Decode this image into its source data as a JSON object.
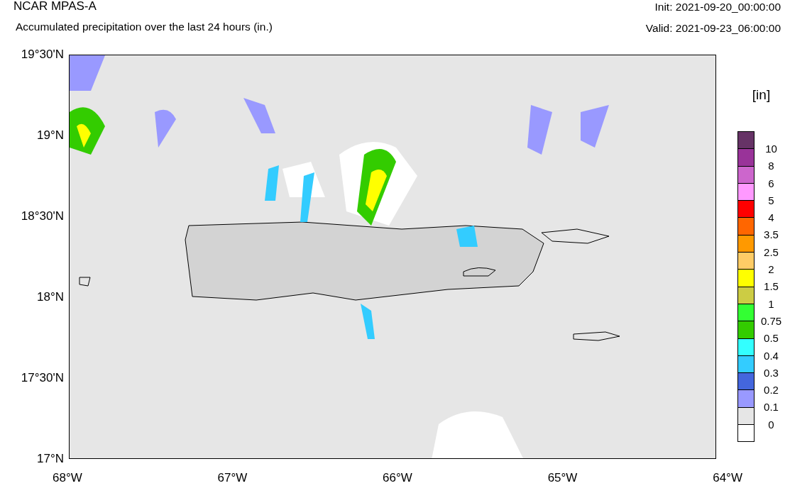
{
  "header": {
    "model": "NCAR MPAS-A",
    "subtitle": "Accumulated precipitation over the last 24 hours (in.)",
    "init": "Init: 2021-09-20_00:00:00",
    "valid": "Valid: 2021-09-23_06:00:00"
  },
  "map": {
    "y_labels": [
      "19°30'N",
      "19°N",
      "18°30'N",
      "18°N",
      "17°30'N",
      "17°N"
    ],
    "x_labels": [
      "68°W",
      "67°W",
      "66°W",
      "65°W",
      "64°W"
    ]
  },
  "legend": {
    "unit": "[in]",
    "bins": [
      {
        "color": "#663366"
      },
      {
        "color": "#993399"
      },
      {
        "color": "#cc66cc"
      },
      {
        "color": "#ff99ff"
      },
      {
        "color": "#ff0000"
      },
      {
        "color": "#ff6600"
      },
      {
        "color": "#ff9900"
      },
      {
        "color": "#ffcc66"
      },
      {
        "color": "#ffff00"
      },
      {
        "color": "#cccc44"
      },
      {
        "color": "#33ff33"
      },
      {
        "color": "#33cc00"
      },
      {
        "color": "#33ffff"
      },
      {
        "color": "#33ccff"
      },
      {
        "color": "#4466dd"
      },
      {
        "color": "#9999ff"
      },
      {
        "color": "#e6e6e6"
      },
      {
        "color": "#ffffff"
      }
    ],
    "labels": [
      "10",
      "8",
      "6",
      "5",
      "4",
      "3.5",
      "2.5",
      "2",
      "1.5",
      "1",
      "0.75",
      "0.5",
      "0.4",
      "0.3",
      "0.2",
      "0.1",
      "0"
    ]
  }
}
